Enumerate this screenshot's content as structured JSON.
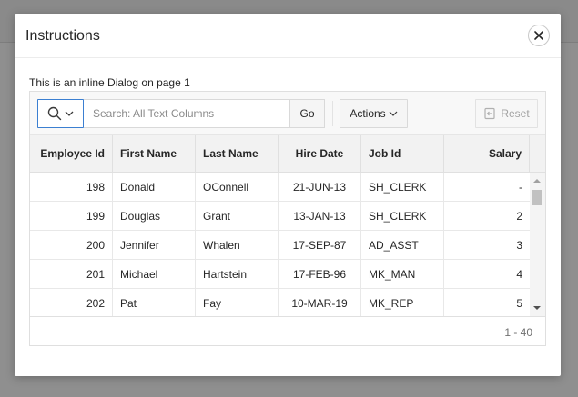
{
  "dialog": {
    "title": "Instructions",
    "close_icon": "close-icon",
    "inline_text": "This is an inline Dialog on page 1"
  },
  "toolbar": {
    "search_placeholder": "Search: All Text Columns",
    "search_value": "",
    "go_label": "Go",
    "actions_label": "Actions",
    "reset_label": "Reset",
    "icons": [
      "search-icon",
      "chevron-down-icon",
      "reset-icon"
    ]
  },
  "grid": {
    "columns": [
      "Employee Id",
      "First Name",
      "Last Name",
      "Hire Date",
      "Job Id",
      "Salary"
    ],
    "rows": [
      [
        "198",
        "Donald",
        "OConnell",
        "21-JUN-13",
        "SH_CLERK",
        "-"
      ],
      [
        "199",
        "Douglas",
        "Grant",
        "13-JAN-13",
        "SH_CLERK",
        "2"
      ],
      [
        "200",
        "Jennifer",
        "Whalen",
        "17-SEP-87",
        "AD_ASST",
        "3"
      ],
      [
        "201",
        "Michael",
        "Hartstein",
        "17-FEB-96",
        "MK_MAN",
        "4"
      ],
      [
        "202",
        "Pat",
        "Fay",
        "10-MAR-19",
        "MK_REP",
        "5"
      ]
    ],
    "pagination": "1 - 40"
  },
  "colors": {
    "accent": "#3b7fd1",
    "header_bg": "#f2f2f2",
    "toolbar_bg": "#f8f8f8"
  }
}
